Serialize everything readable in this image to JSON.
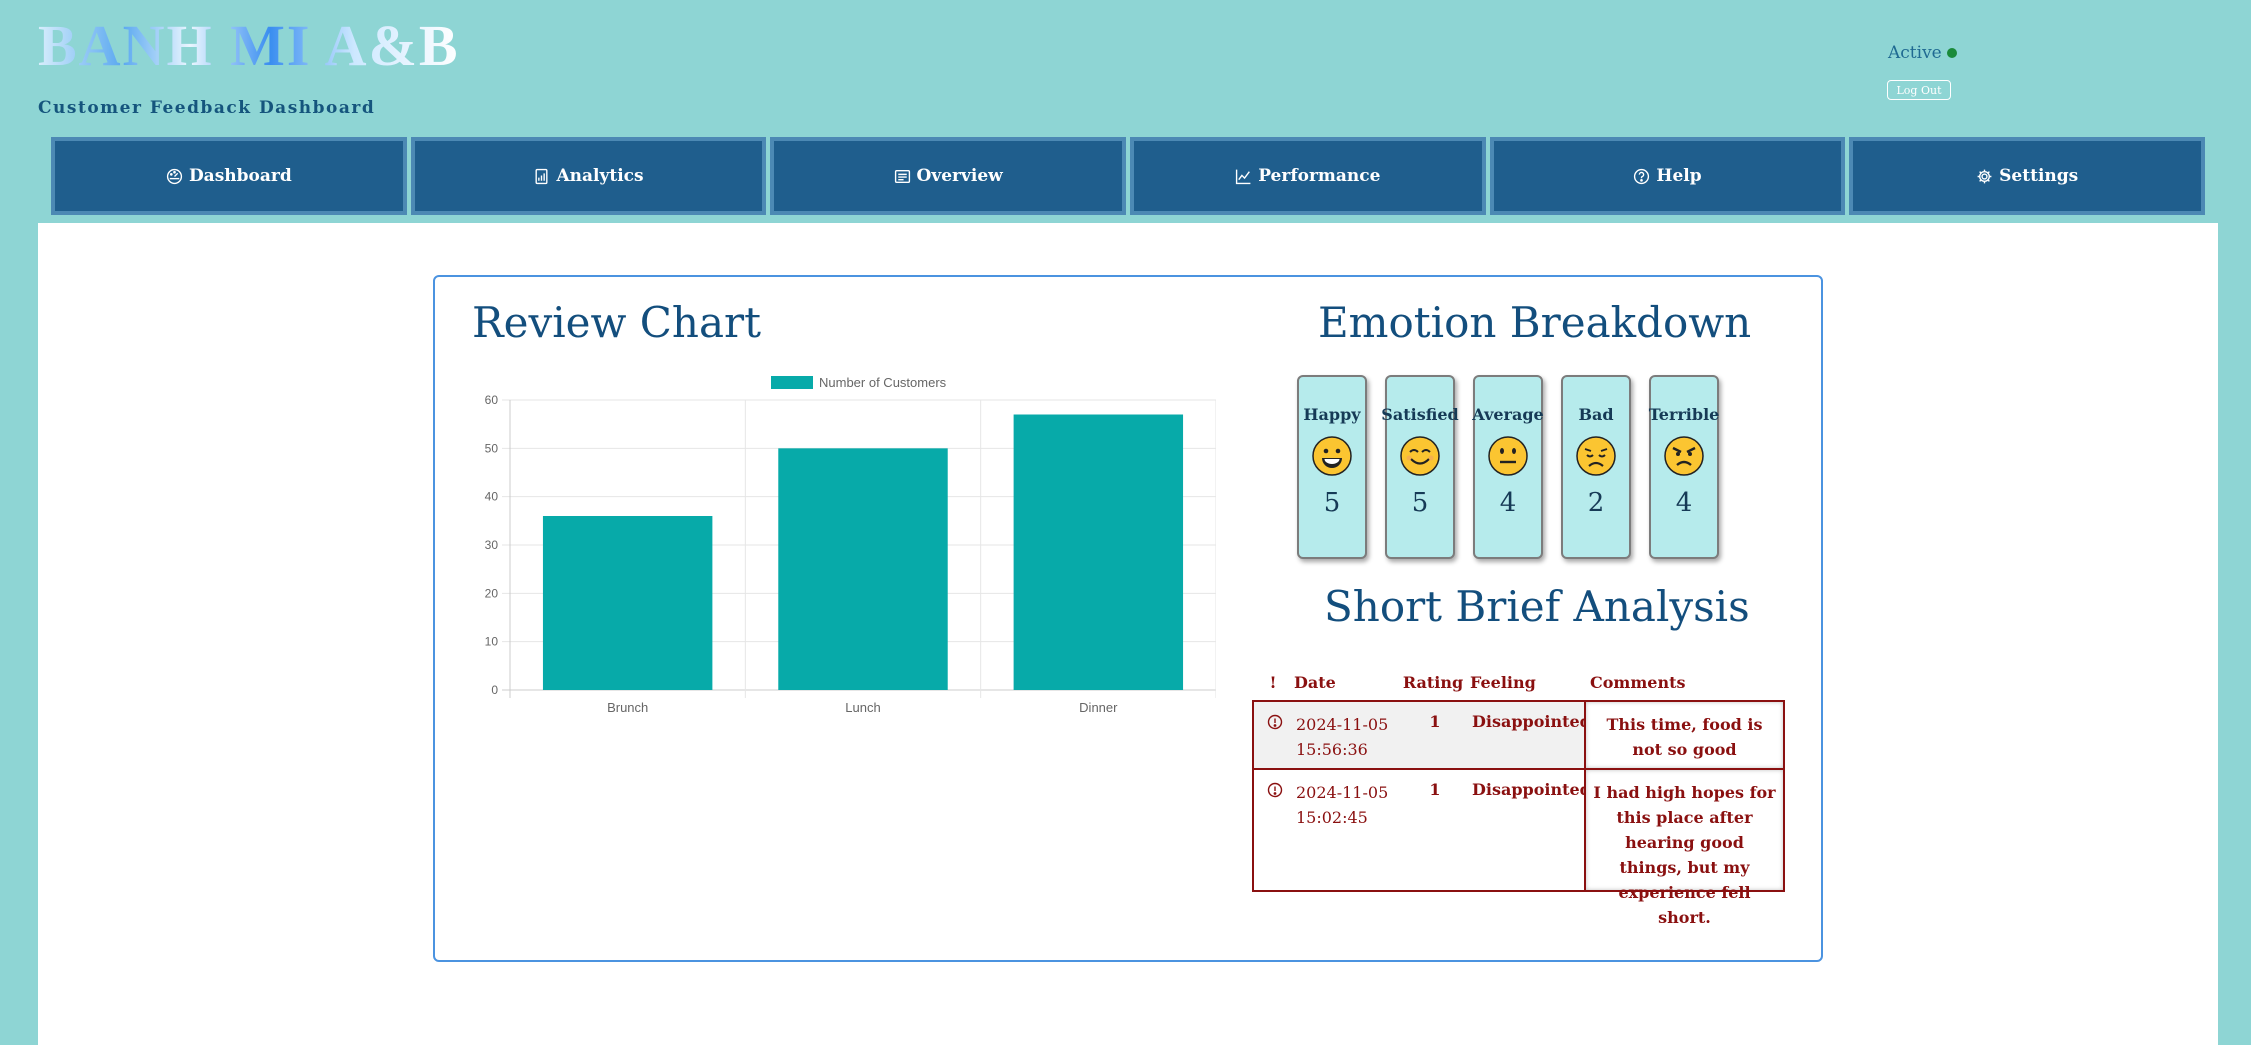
{
  "brand": {
    "logo": "BANH MI A&B",
    "subtitle": "Customer Feedback Dashboard"
  },
  "status": {
    "label": "Active",
    "logout": "Log Out"
  },
  "nav": [
    {
      "label": "Dashboard",
      "icon": "dashboard-icon"
    },
    {
      "label": "Analytics",
      "icon": "analytics-icon"
    },
    {
      "label": "Overview",
      "icon": "overview-icon"
    },
    {
      "label": "Performance",
      "icon": "performance-icon"
    },
    {
      "label": "Help",
      "icon": "help-icon"
    },
    {
      "label": "Settings",
      "icon": "gear-icon"
    }
  ],
  "review": {
    "title": "Review Chart"
  },
  "chart_data": {
    "type": "bar",
    "categories": [
      "Brunch",
      "Lunch",
      "Dinner"
    ],
    "series": [
      {
        "name": "Number of Customers",
        "values": [
          36,
          50,
          57
        ],
        "color": "#07aaa9"
      }
    ],
    "ylim": [
      0,
      60
    ],
    "yticks": [
      0,
      10,
      20,
      30,
      40,
      50,
      60
    ],
    "grid": true,
    "legend": "top-center"
  },
  "emotion": {
    "title": "Emotion Breakdown",
    "items": [
      {
        "label": "Happy",
        "count": "5",
        "icon": "grinning-face-icon"
      },
      {
        "label": "Satisfied",
        "count": "5",
        "icon": "smiling-face-icon"
      },
      {
        "label": "Average",
        "count": "4",
        "icon": "neutral-face-icon"
      },
      {
        "label": "Bad",
        "count": "2",
        "icon": "disappointed-face-icon"
      },
      {
        "label": "Terrible",
        "count": "4",
        "icon": "angry-face-icon"
      }
    ]
  },
  "analysis": {
    "title": "Short Brief Analysis",
    "headers": [
      "!",
      "Date",
      "Rating",
      "Feeling",
      "Comments"
    ],
    "rows": [
      {
        "date": "2024-11-05 15:56:36",
        "rating": "1",
        "feeling": "Disappointed",
        "comment": "This time, food is not so good"
      },
      {
        "date": "2024-11-05 15:02:45",
        "rating": "1",
        "feeling": "Disappointed",
        "comment": "I had high hopes for this place after hearing good things, but my experience fell short."
      }
    ]
  },
  "colors": {
    "accent": "#1f5e8d",
    "bar": "#07aaa9",
    "alert": "#8a1010",
    "background": "#8ed5d4"
  }
}
